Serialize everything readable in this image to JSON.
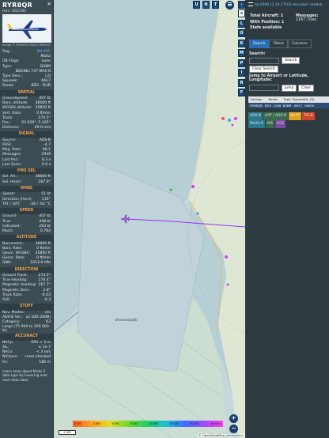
{
  "aircraft": {
    "callsign": "RYR8QR",
    "hex": "Hex: 4D2383",
    "close": "×",
    "photo_credit": "Image © Florencio Martin Molinar",
    "reg_label": "Reg.:",
    "reg": "9H-VVC",
    "country": "Malta",
    "db_flags_label": "DB Flags:",
    "db_flags": "none",
    "type_label": "Type:",
    "type": "B38M",
    "type_desc": "BOEING 737 MAX 8",
    "type_desc_label": "Type Desc.:",
    "type_desc_val": "L2J",
    "squawk_label": "Squawk:",
    "squawk": "6617",
    "route_label": "Route:",
    "route": "BZG - DUB"
  },
  "sections": {
    "spatial": {
      "title": "SPATIAL",
      "rows": [
        {
          "k": "Groundspeed:",
          "v": "407 kt"
        },
        {
          "k": "Baro. altitude:",
          "v": "36000 ft"
        },
        {
          "k": "WGS84 altitude:",
          "v": "35850 ft"
        },
        {
          "k": "Vert. Rate:",
          "v": "0 ft/min"
        },
        {
          "k": "Track:",
          "v": "274.5°"
        },
        {
          "k": "Pos.:",
          "v": "53.029°, 5.165°"
        },
        {
          "k": "Distance:",
          "v": "29.0 nmi"
        }
      ]
    },
    "signal": {
      "title": "SIGNAL",
      "rows": [
        {
          "k": "Source:",
          "v": "ADS-B"
        },
        {
          "k": "RSSI:",
          "v": "-4.7"
        },
        {
          "k": "Msg. Rate:",
          "v": "68.1"
        },
        {
          "k": "Messages:",
          "v": "2939"
        },
        {
          "k": "Last Pos.:",
          "v": "0.3 s"
        },
        {
          "k": "Last Seen:",
          "v": "0.0 s"
        }
      ]
    },
    "fms": {
      "title": "FMS SEL",
      "rows": [
        {
          "k": "Sel. Alt.:",
          "v": "36000 ft"
        },
        {
          "k": "Sel. Head.:",
          "v": "267.9°"
        }
      ]
    },
    "wind": {
      "title": "WIND",
      "rows": [
        {
          "k": "Speed:",
          "v": "51 kt"
        },
        {
          "k": "Direction (from):",
          "v": "235°"
        },
        {
          "k": "TAT / OAT:",
          "v": "-26 / -62 °C"
        }
      ]
    },
    "speed": {
      "title": "SPEED",
      "rows": [
        {
          "k": "Ground:",
          "v": "407 kt"
        },
        {
          "k": "True:",
          "v": "448 kt"
        },
        {
          "k": "Indicated:",
          "v": "263 kt"
        },
        {
          "k": "Mach:",
          "v": "0.792"
        }
      ]
    },
    "altitude": {
      "title": "ALTITUDE",
      "rows": [
        {
          "k": "Barometric:",
          "v": "36000 ft"
        },
        {
          "k": "Baro. Rate:",
          "v": "0 ft/min"
        },
        {
          "k": "Geom. WGS84:",
          "v": "35850 ft"
        },
        {
          "k": "Geom. Rate:",
          "v": "0 ft/min"
        },
        {
          "k": "QNH:",
          "v": "1013.6 hPa"
        }
      ]
    },
    "direction": {
      "title": "DIRECTION",
      "rows": [
        {
          "k": "Ground Track:",
          "v": "274.5°"
        },
        {
          "k": "True Heading:",
          "v": "270.4°"
        },
        {
          "k": "Magnetic Heading:",
          "v": "267.7°"
        },
        {
          "k": "Magnetic Decl.:",
          "v": "2.8°"
        },
        {
          "k": "Track Rate:",
          "v": "-0.03"
        },
        {
          "k": "Roll:",
          "v": "-0.3"
        }
      ]
    },
    "stuff": {
      "title": "STUFF",
      "rows": [
        {
          "k": "Nav. Modes:",
          "v": "n/a"
        },
        {
          "k": "ADS-B Ver.:",
          "v": "v2 (DO-260B)"
        },
        {
          "k": "Category:",
          "v": "A3"
        }
      ],
      "note": "Large (75 000 to 300 000 lb)"
    },
    "accuracy": {
      "title": "ACCURACY",
      "rows": [
        {
          "k": "NACp:",
          "v": "EPU < 3 m"
        },
        {
          "k": "SIL:",
          "v": "≤ 1e-7"
        },
        {
          "k": "NACv:",
          "v": "< 3 m/s"
        },
        {
          "k": "NICbaro:",
          "v": "cross-checked"
        },
        {
          "k": "Rc:",
          "v": "186 m"
        }
      ],
      "footer": "Learn more about Mode S data type by hovering over each data label."
    }
  },
  "map": {
    "toolbar": [
      "U",
      "H",
      "T"
    ],
    "side_buttons": [
      "<",
      "⊙",
      "L",
      "O",
      "K",
      "M",
      "P",
      "I",
      "R",
      "F"
    ],
    "zoom_in": "+",
    "zoom_out": "−",
    "place": "Breezanddijk",
    "scale": "2 NM",
    "attribution": "© OpenStreetMap contributors.",
    "alt_ticks": [
      "2 000",
      "4 000",
      "6 000",
      "8 000",
      "10 000",
      "20 000",
      "30 000",
      "40 000+"
    ]
  },
  "right": {
    "version": "tar1090 (3.14.1793) decoder: readsb",
    "total_label": "Total Aircraft: 1",
    "messages_label": "Messages:",
    "messages_val": "1167.7/sec",
    "with_pos": "With Position: 1",
    "stats": "Stats available",
    "tabs": [
      "Search",
      "Filters",
      "Columns"
    ],
    "search_label": "Search:",
    "search_btn": "Search",
    "clear_btn": "Clear Search",
    "jump_label": "Jump to Airport or Latitude, Longitude:",
    "jump_btn": "Jump",
    "clear2": "Clear",
    "cols": [
      "Callsign",
      "Route",
      "Type",
      "Squawk",
      "Alt. (ft)"
    ],
    "row": {
      "callsign": "RYR8QR",
      "route": "BZG - DUB",
      "type": "B38M",
      "squawk": "6617",
      "alt": "36000"
    },
    "chips": [
      "ADS-B",
      "UAT / ADS-R",
      "MLAT",
      "TIS-B",
      "Mode-S",
      "AIS",
      "CCE"
    ]
  },
  "colors": {
    "accent": "#f3a34a",
    "panel": "#3b4c53",
    "map_water": "#b6cfd4",
    "track": "#9b30ff"
  }
}
